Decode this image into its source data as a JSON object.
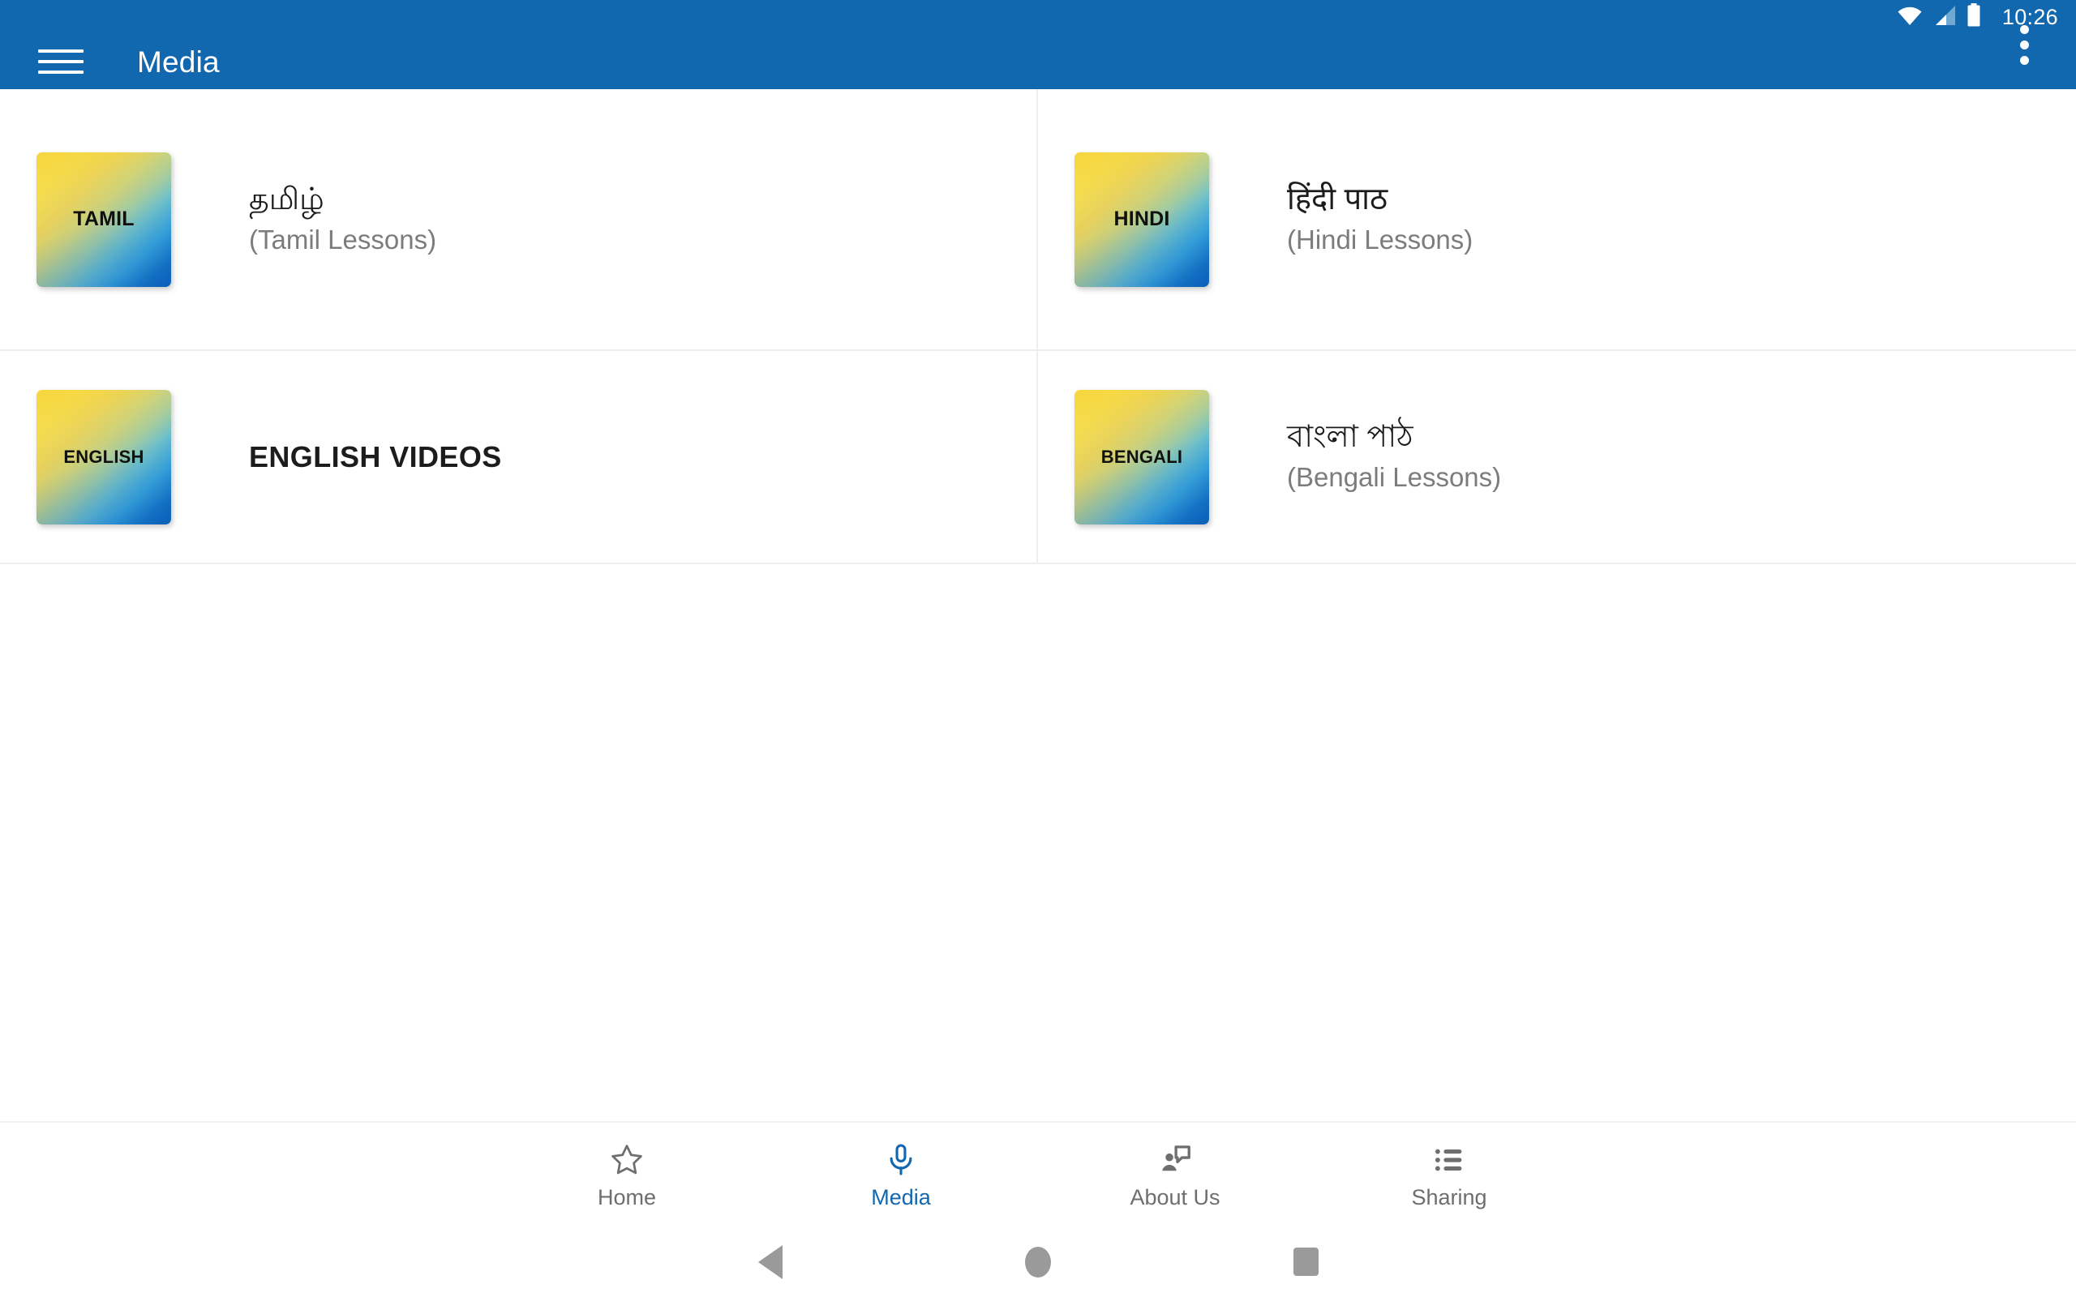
{
  "status_bar": {
    "time": "10:26",
    "icons": [
      "wifi-icon",
      "signal-icon",
      "battery-icon"
    ]
  },
  "app_bar": {
    "menu_icon": "hamburger-menu-icon",
    "title": "Media",
    "overflow_icon": "overflow-menu-icon",
    "background_color": "#1268af",
    "text_color": "#ffffff"
  },
  "media_grid": {
    "rows": [
      {
        "cells": [
          {
            "thumb_label": "TAMIL",
            "title": "தமிழ்",
            "subtitle": "(Tamil Lessons)"
          },
          {
            "thumb_label": "HINDI",
            "title": "हिंदी पाठ",
            "subtitle": "(Hindi Lessons)"
          }
        ]
      },
      {
        "cells": [
          {
            "thumb_label": "ENGLISH",
            "title": "ENGLISH VIDEOS",
            "subtitle": ""
          },
          {
            "thumb_label": "BENGALI",
            "title": "বাংলা পাঠ",
            "subtitle": "(Bengali Lessons)"
          }
        ]
      }
    ]
  },
  "bottom_nav": {
    "active_color": "#1268af",
    "inactive_color": "#6e6e6e",
    "items": [
      {
        "label": "Home",
        "icon": "star-outline-icon",
        "active": false
      },
      {
        "label": "Media",
        "icon": "microphone-icon",
        "active": true
      },
      {
        "label": "About Us",
        "icon": "person-speech-bubble-icon",
        "active": false
      },
      {
        "label": "Sharing",
        "icon": "bulleted-list-icon",
        "active": false
      }
    ]
  },
  "system_nav": {
    "back": "back-triangle-icon",
    "home": "home-circle-icon",
    "recents": "recents-square-icon"
  }
}
